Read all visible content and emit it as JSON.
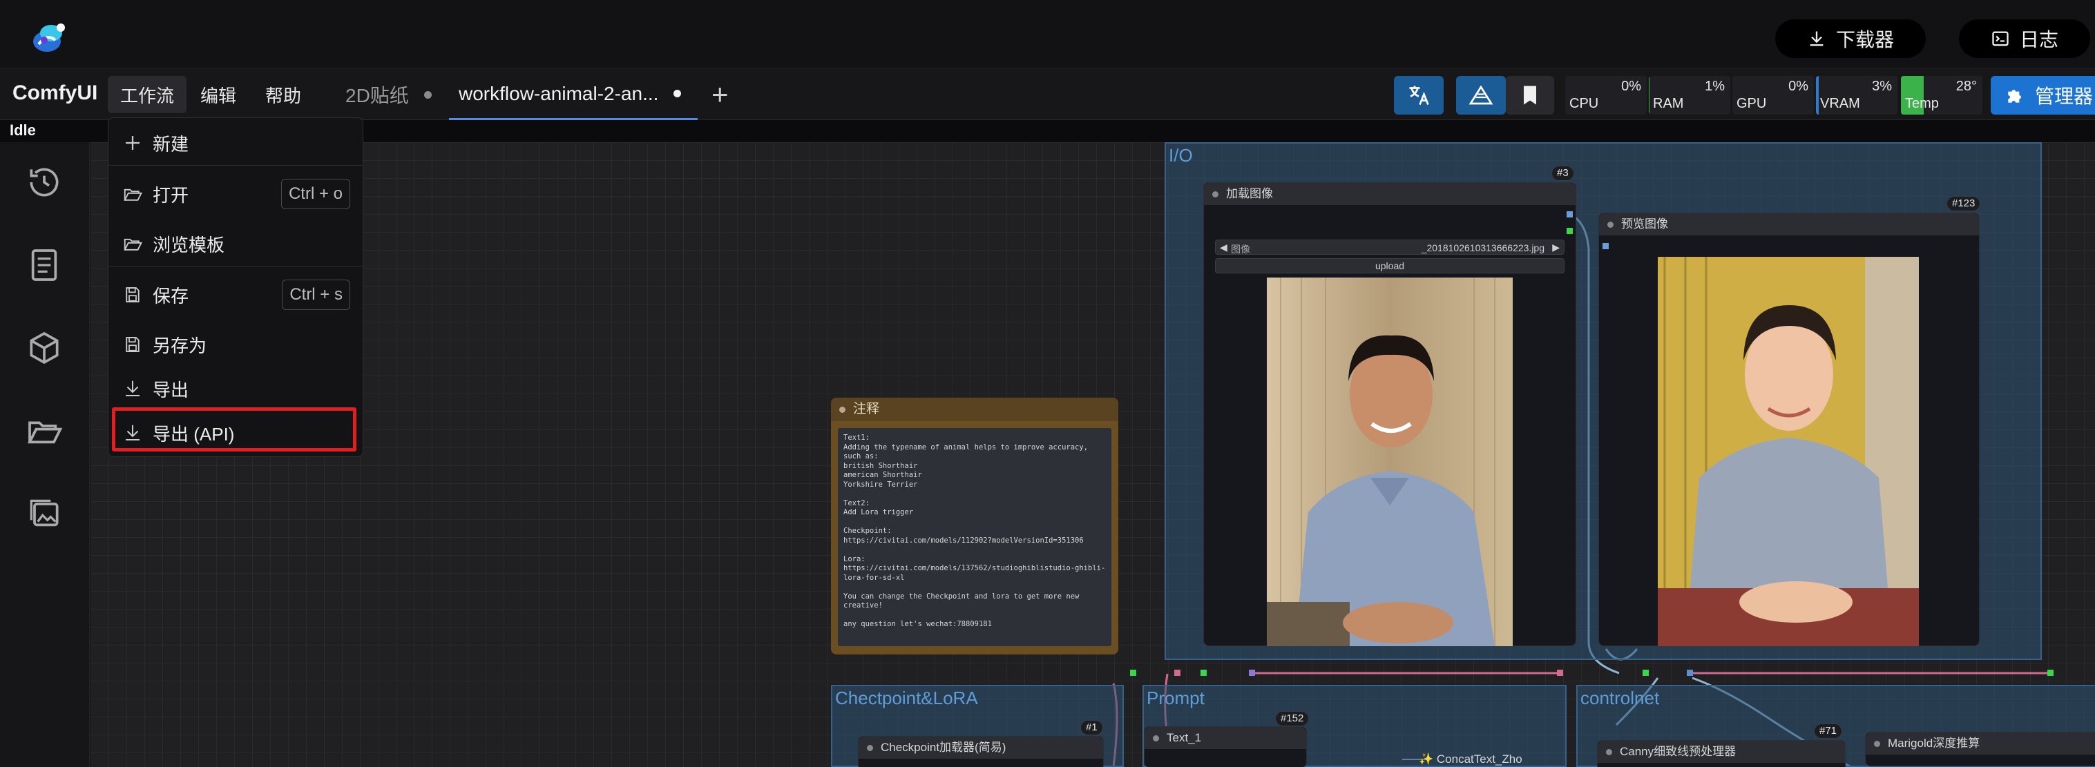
{
  "topbar": {
    "downloader_label": "下载器",
    "log_label": "日志"
  },
  "menubar": {
    "brand": "ComfyUI",
    "items": [
      "工作流",
      "编辑",
      "帮助"
    ]
  },
  "tabs": [
    {
      "label": "2D贴纸"
    },
    {
      "label": "workflow-animal-2-an..."
    }
  ],
  "toolbar": {
    "stats": [
      {
        "label": "CPU",
        "value": "0%",
        "fill": 0.0
      },
      {
        "label": "RAM",
        "value": "1%",
        "fill": 0.01
      },
      {
        "label": "GPU",
        "value": "0%",
        "fill": 0.0
      },
      {
        "label": "VRAM",
        "value": "3%",
        "fill": 0.03
      },
      {
        "label": "Temp",
        "value": "28°",
        "fill": 0.28
      }
    ],
    "manager_label": "管理器"
  },
  "status": "Idle",
  "workflow_menu": {
    "items": [
      {
        "label": "新建",
        "icon": "plus-icon",
        "shortcut": ""
      },
      {
        "label": "打开",
        "icon": "folder-open-icon",
        "shortcut": "Ctrl + o"
      },
      {
        "label": "浏览模板",
        "icon": "folder-open-icon",
        "shortcut": ""
      },
      {
        "label": "保存",
        "icon": "save-icon",
        "shortcut": "Ctrl + s"
      },
      {
        "label": "另存为",
        "icon": "save-icon",
        "shortcut": ""
      },
      {
        "label": "导出",
        "icon": "download-icon",
        "shortcut": ""
      },
      {
        "label": "导出 (API)",
        "icon": "download-icon",
        "shortcut": ""
      }
    ]
  },
  "canvas": {
    "groups": {
      "io": "I/O",
      "checkpoint": "Chectpoint&LoRA",
      "prompt": "Prompt",
      "controlnet": "controlnet"
    },
    "note": {
      "title": "注释",
      "text": "Text1:\nAdding the typename of animal helps to improve accuracy, such as:\nbritish Shorthair\namerican Shorthair\nYorkshire Terrier\n\nText2:\nAdd Lora trigger\n\nCheckpoint:\nhttps://civitai.com/models/112902?modelVersionId=351306\n\nLora:\nhttps://civitai.com/models/137562/studioghiblistudio-ghibli-lora-for-sd-xl\n\nYou can change the Checkpoint and lora to get more new creative!\n\nany question let's wechat:78809181"
    },
    "load_image": {
      "badge": "#3",
      "title": "加载图像",
      "widget_label": "图像",
      "widget_value": "_20181026103136662​23.jpg",
      "upload_label": "upload"
    },
    "preview_image": {
      "badge": "#123",
      "title": "预览图像"
    },
    "checkpoint_node": {
      "badge": "#1",
      "title": "Checkpoint加载器(简易)"
    },
    "text_node": {
      "badge": "#152",
      "title": "Text_1",
      "concat": "ConcatText_Zho"
    },
    "canny_node": {
      "badge": "#71",
      "title": "Canny细致线预处理器"
    },
    "marigold_node": {
      "title": "Marigold深度推算"
    }
  },
  "colors": {
    "accent": "#1c73d1",
    "highlight": "#e02020",
    "group_title": "#5e9ed8",
    "temp_bar": "#3bb24a"
  }
}
